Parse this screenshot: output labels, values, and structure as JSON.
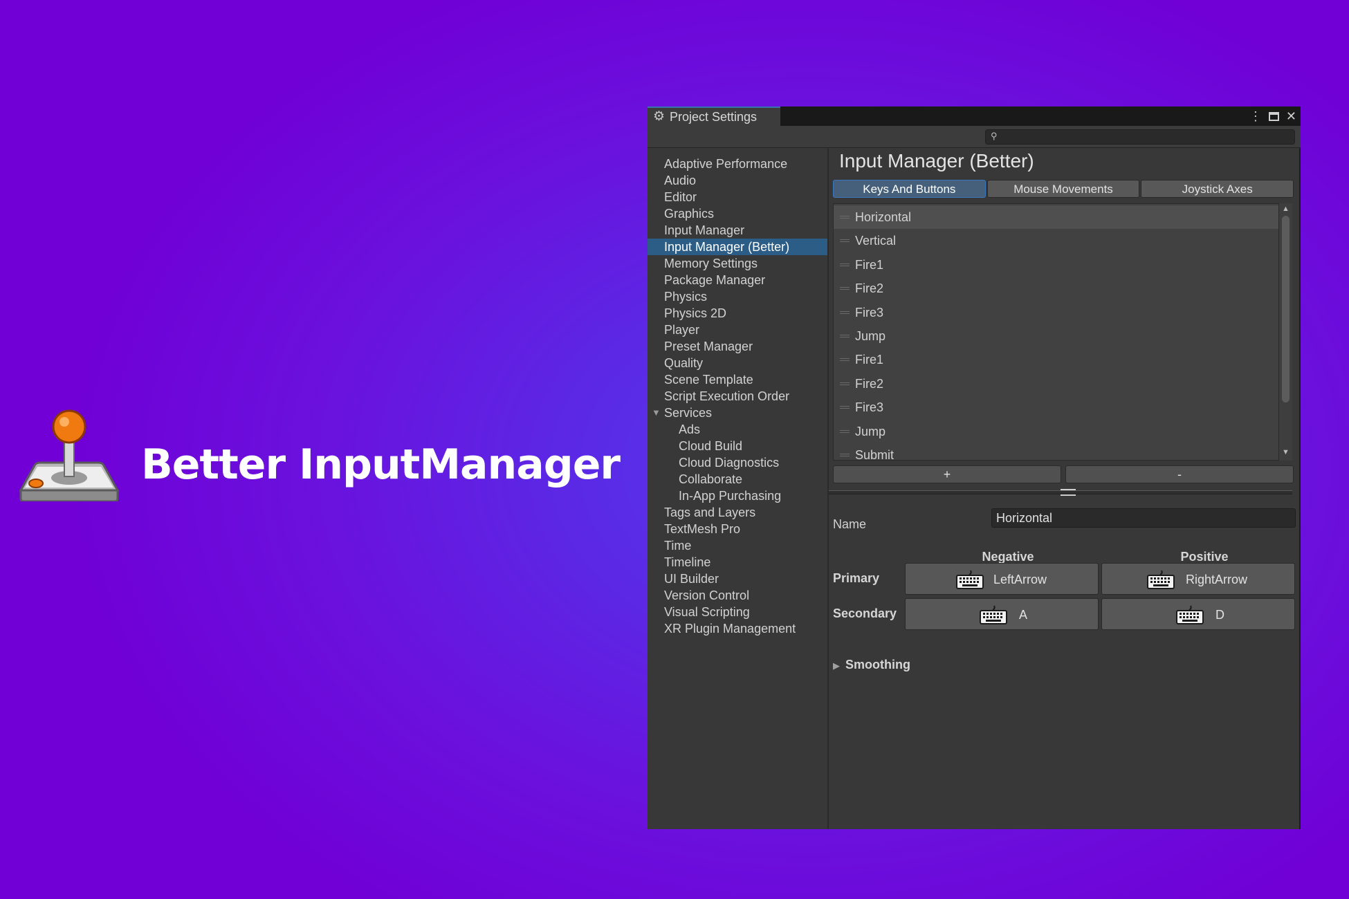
{
  "hero": {
    "title": "Better InputManager"
  },
  "window": {
    "tab_title": "Project Settings",
    "controls": {
      "menu": "⋮",
      "close": "✕"
    }
  },
  "sidebar": {
    "items": [
      {
        "label": "Adaptive Performance"
      },
      {
        "label": "Audio"
      },
      {
        "label": "Editor"
      },
      {
        "label": "Graphics"
      },
      {
        "label": "Input Manager"
      },
      {
        "label": "Input Manager (Better)",
        "selected": true
      },
      {
        "label": "Memory Settings"
      },
      {
        "label": "Package Manager"
      },
      {
        "label": "Physics"
      },
      {
        "label": "Physics 2D"
      },
      {
        "label": "Player"
      },
      {
        "label": "Preset Manager"
      },
      {
        "label": "Quality"
      },
      {
        "label": "Scene Template"
      },
      {
        "label": "Script Execution Order"
      },
      {
        "label": "Services",
        "expanded": true
      },
      {
        "label": "Ads",
        "child": true
      },
      {
        "label": "Cloud Build",
        "child": true
      },
      {
        "label": "Cloud Diagnostics",
        "child": true
      },
      {
        "label": "Collaborate",
        "child": true
      },
      {
        "label": "In-App Purchasing",
        "child": true
      },
      {
        "label": "Tags and Layers"
      },
      {
        "label": "TextMesh Pro"
      },
      {
        "label": "Time"
      },
      {
        "label": "Timeline"
      },
      {
        "label": "UI Builder"
      },
      {
        "label": "Version Control"
      },
      {
        "label": "Visual Scripting"
      },
      {
        "label": "XR Plugin Management"
      }
    ]
  },
  "content": {
    "title": "Input Manager (Better)",
    "tabs": [
      {
        "label": "Keys And Buttons",
        "active": true
      },
      {
        "label": "Mouse Movements"
      },
      {
        "label": "Joystick Axes"
      }
    ],
    "axes": [
      "Horizontal",
      "Vertical",
      "Fire1",
      "Fire2",
      "Fire3",
      "Jump",
      "Fire1",
      "Fire2",
      "Fire3",
      "Jump",
      "Submit"
    ],
    "add_label": "+",
    "remove_label": "-",
    "name_label": "Name",
    "name_value": "Horizontal",
    "negative_label": "Negative",
    "positive_label": "Positive",
    "primary_label": "Primary",
    "secondary_label": "Secondary",
    "primary_negative": "LeftArrow",
    "primary_positive": "RightArrow",
    "secondary_negative": "A",
    "secondary_positive": "D",
    "smoothing_label": "Smoothing"
  },
  "colors": {
    "background": "#6a12de",
    "selection": "#2c5d87",
    "active_tab": "#46607c"
  }
}
